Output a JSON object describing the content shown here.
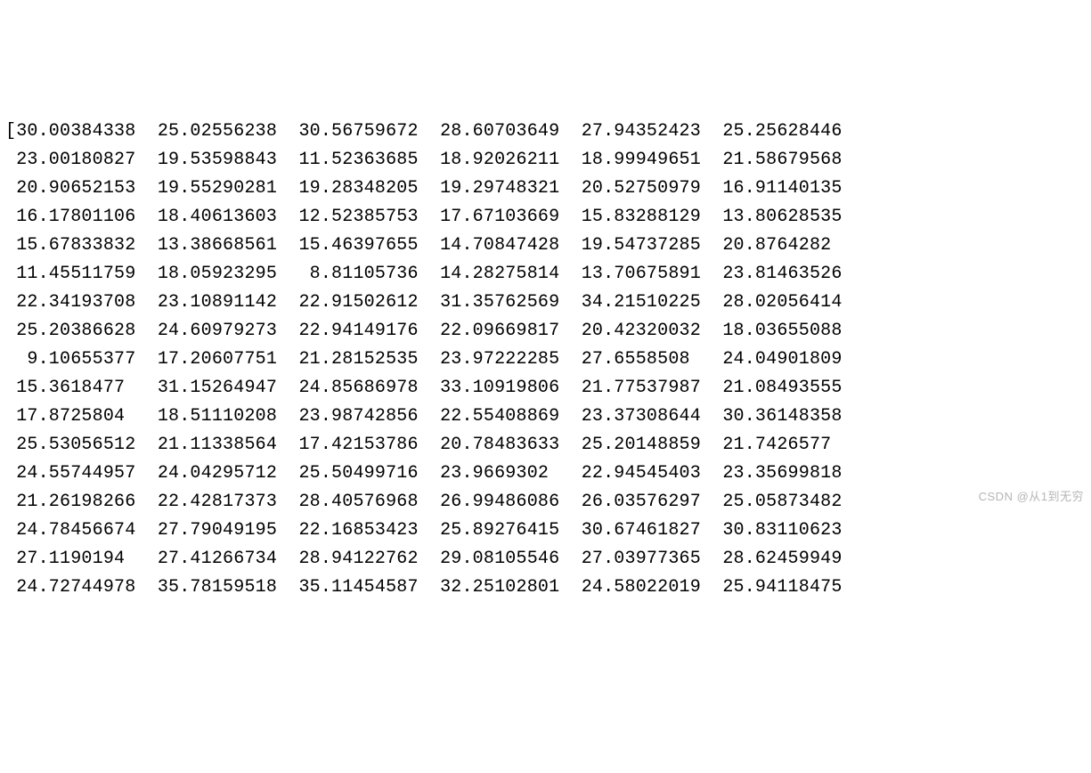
{
  "array_output": {
    "open_bracket": "[",
    "rows": [
      [
        "30.00384338",
        "25.02556238",
        "30.56759672",
        "28.60703649",
        "27.94352423",
        "25.25628446"
      ],
      [
        "23.00180827",
        "19.53598843",
        "11.52363685",
        "18.92026211",
        "18.99949651",
        "21.58679568"
      ],
      [
        "20.90652153",
        "19.55290281",
        "19.28348205",
        "19.29748321",
        "20.52750979",
        "16.91140135"
      ],
      [
        "16.17801106",
        "18.40613603",
        "12.52385753",
        "17.67103669",
        "15.83288129",
        "13.80628535"
      ],
      [
        "15.67833832",
        "13.38668561",
        "15.46397655",
        "14.70847428",
        "19.54737285",
        "20.8764282 "
      ],
      [
        "11.45511759",
        "18.05923295",
        " 8.81105736",
        "14.28275814",
        "13.70675891",
        "23.81463526"
      ],
      [
        "22.34193708",
        "23.10891142",
        "22.91502612",
        "31.35762569",
        "34.21510225",
        "28.02056414"
      ],
      [
        "25.20386628",
        "24.60979273",
        "22.94149176",
        "22.09669817",
        "20.42320032",
        "18.03655088"
      ],
      [
        " 9.10655377",
        "17.20607751",
        "21.28152535",
        "23.97222285",
        "27.6558508 ",
        "24.04901809"
      ],
      [
        "15.3618477 ",
        "31.15264947",
        "24.85686978",
        "33.10919806",
        "21.77537987",
        "21.08493555"
      ],
      [
        "17.8725804 ",
        "18.51110208",
        "23.98742856",
        "22.55408869",
        "23.37308644",
        "30.36148358"
      ],
      [
        "25.53056512",
        "21.11338564",
        "17.42153786",
        "20.78483633",
        "25.20148859",
        "21.7426577 "
      ],
      [
        "24.55744957",
        "24.04295712",
        "25.50499716",
        "23.9669302 ",
        "22.94545403",
        "23.35699818"
      ],
      [
        "21.26198266",
        "22.42817373",
        "28.40576968",
        "26.99486086",
        "26.03576297",
        "25.05873482"
      ],
      [
        "24.78456674",
        "27.79049195",
        "22.16853423",
        "25.89276415",
        "30.67461827",
        "30.83110623"
      ],
      [
        "27.1190194 ",
        "27.41266734",
        "28.94122762",
        "29.08105546",
        "27.03977365",
        "28.62459949"
      ],
      [
        "24.72744978",
        "35.78159518",
        "35.11454587",
        "32.25102801",
        "24.58022019",
        "25.94118475"
      ]
    ]
  },
  "watermark": "CSDN @从1到无穷"
}
